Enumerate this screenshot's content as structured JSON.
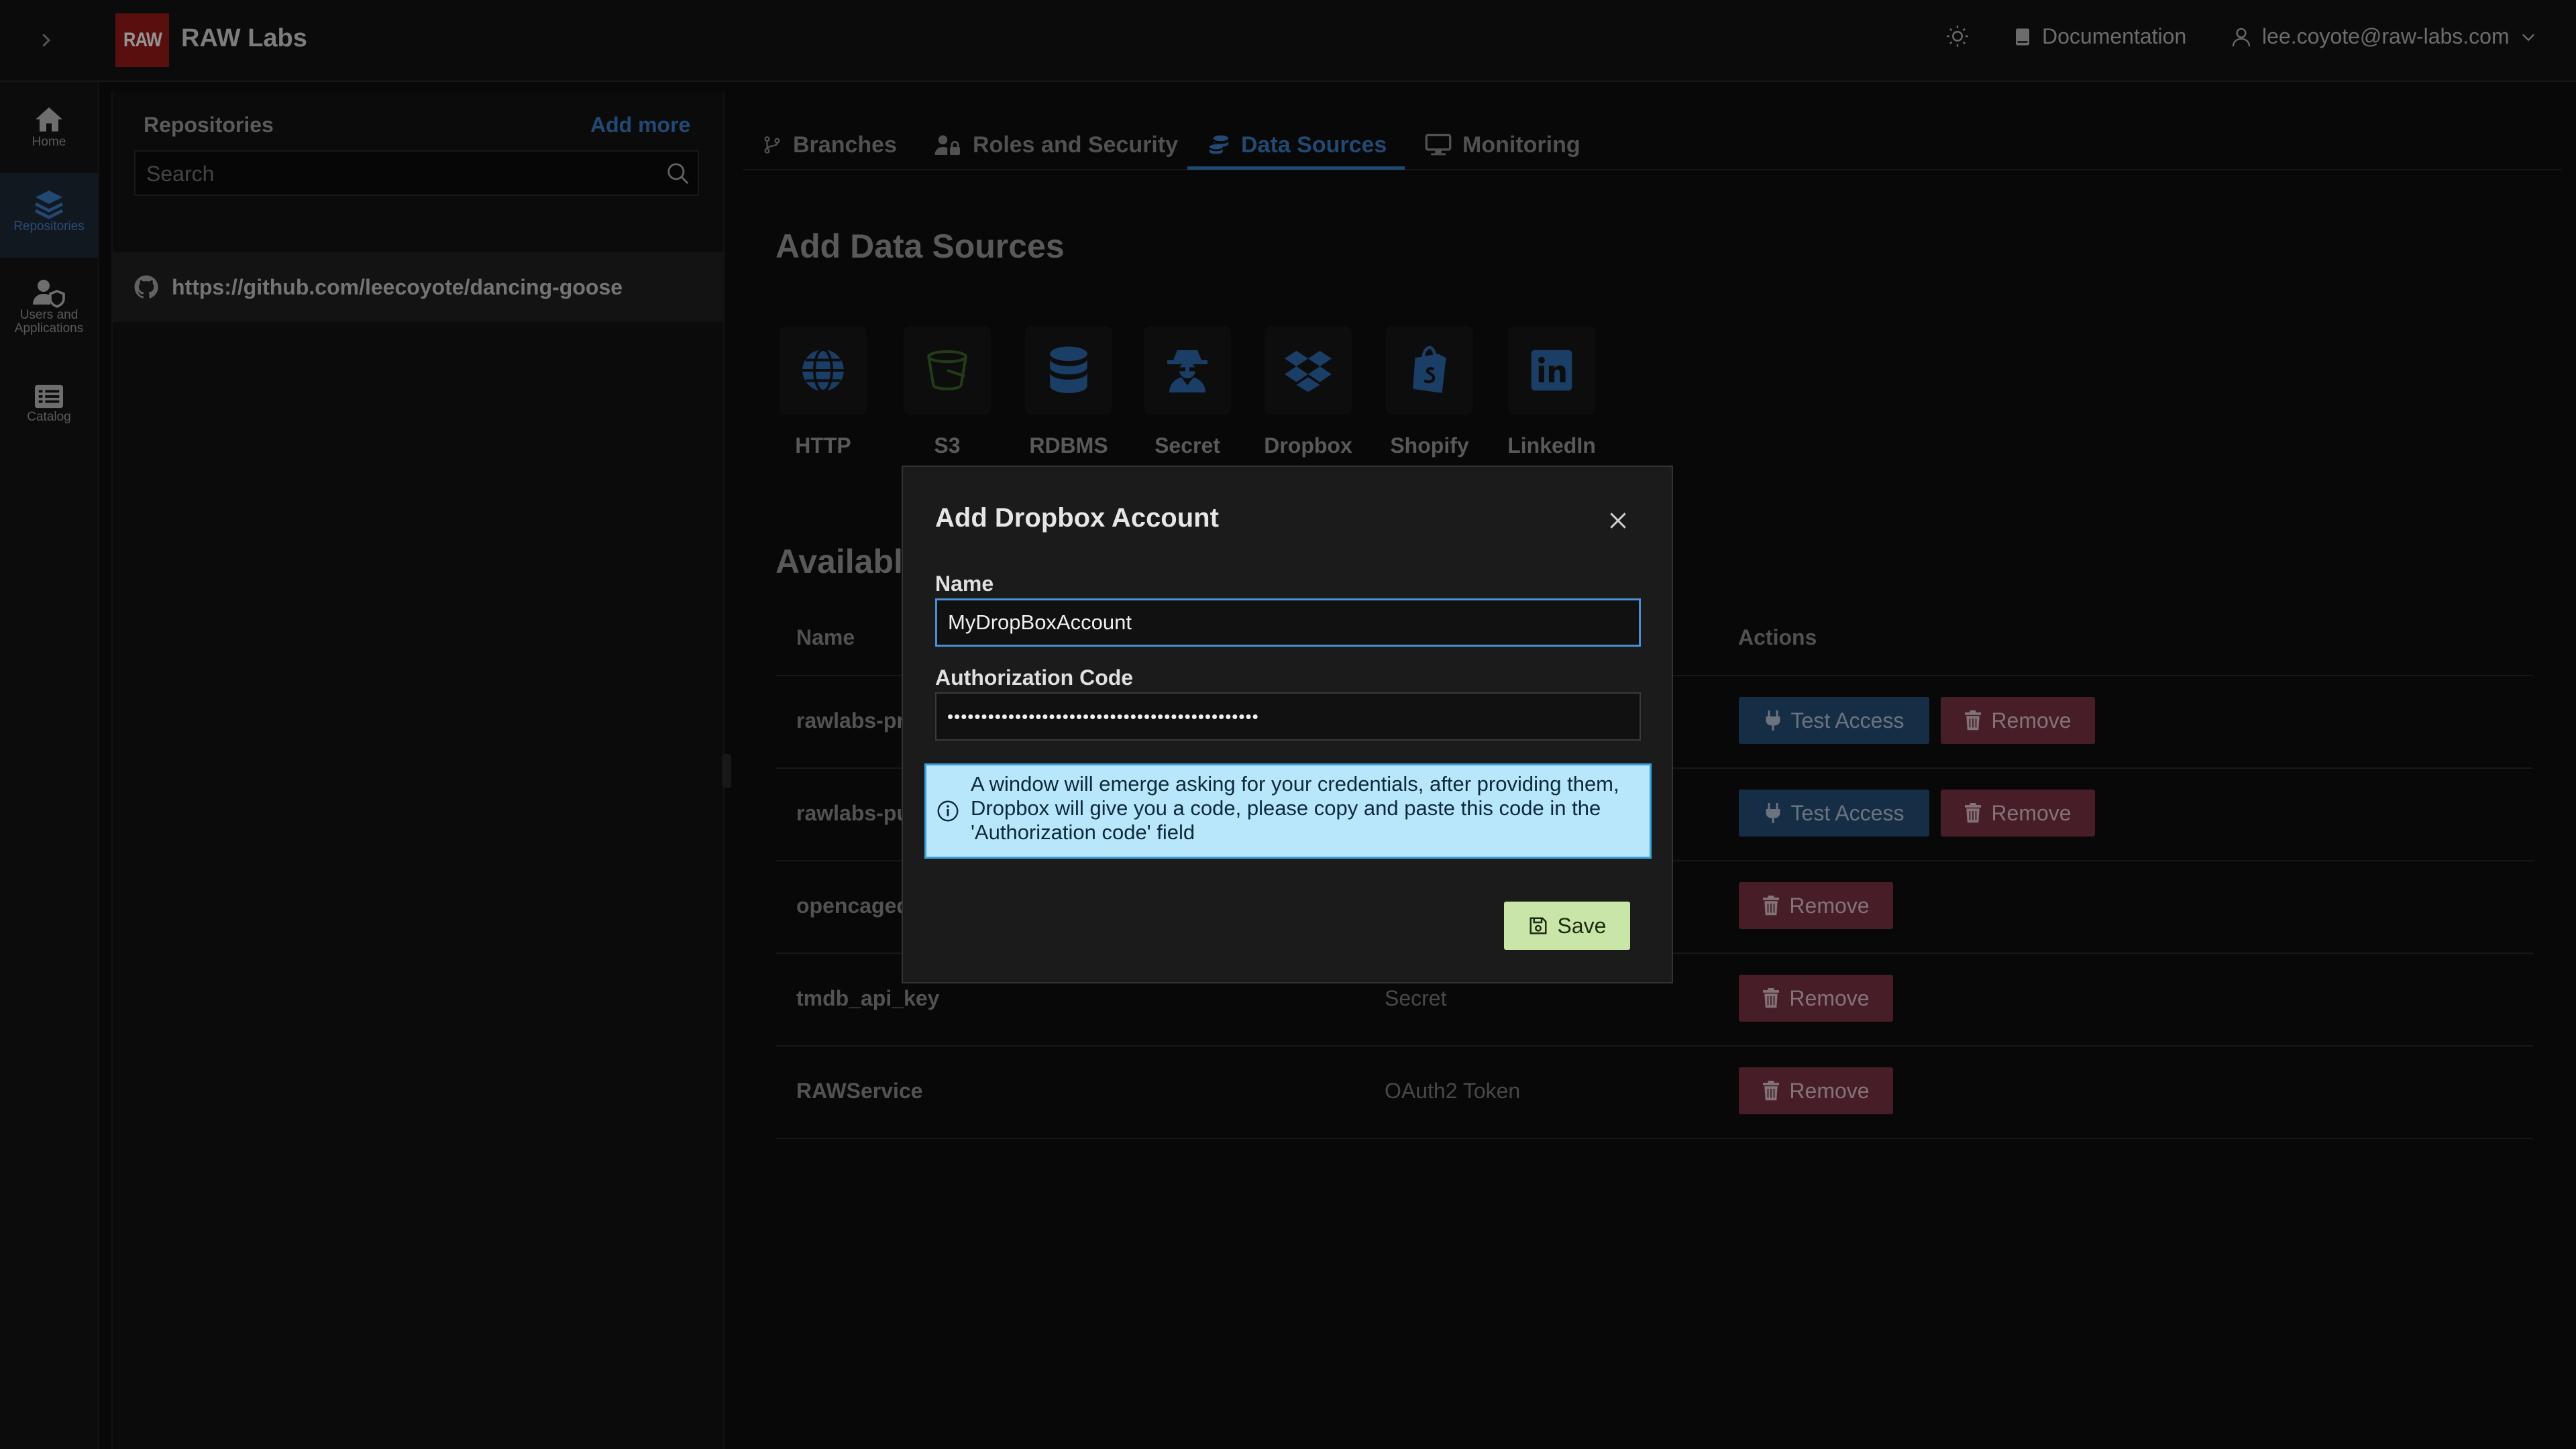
{
  "topbar": {
    "logo_text": "RAW",
    "app_title": "RAW Labs",
    "documentation_label": "Documentation",
    "user_email": "lee.coyote@raw-labs.com"
  },
  "leftnav": {
    "items": [
      {
        "label": "Home",
        "icon": "home-icon"
      },
      {
        "label": "Repositories",
        "icon": "layers-icon"
      },
      {
        "label": "Users and Applications",
        "icon": "users-shield-icon"
      },
      {
        "label": "Catalog",
        "icon": "list-icon"
      }
    ]
  },
  "repos": {
    "title": "Repositories",
    "add_more_label": "Add more",
    "search_placeholder": "Search",
    "items": [
      {
        "url": "https://github.com/leecoyote/dancing-goose",
        "icon": "github-icon"
      }
    ]
  },
  "tabs": [
    {
      "label": "Branches",
      "icon": "branch-icon"
    },
    {
      "label": "Roles and Security",
      "icon": "user-lock-icon"
    },
    {
      "label": "Data Sources",
      "icon": "coins-icon",
      "active": true
    },
    {
      "label": "Monitoring",
      "icon": "monitor-icon"
    }
  ],
  "add_sources": {
    "title": "Add Data Sources",
    "types": [
      {
        "label": "HTTP",
        "icon": "globe-icon"
      },
      {
        "label": "S3",
        "icon": "bucket-icon"
      },
      {
        "label": "RDBMS",
        "icon": "database-icon"
      },
      {
        "label": "Secret",
        "icon": "user-secret-icon"
      },
      {
        "label": "Dropbox",
        "icon": "dropbox-icon"
      },
      {
        "label": "Shopify",
        "icon": "shopify-icon"
      },
      {
        "label": "LinkedIn",
        "icon": "linkedin-icon"
      }
    ]
  },
  "available": {
    "title_visible": "Availabl",
    "headers": {
      "name": "Name",
      "actions": "Actions"
    },
    "rows": [
      {
        "name": "rawlabs-pr",
        "type": "",
        "test": true
      },
      {
        "name": "rawlabs-pu",
        "type": "",
        "test": true
      },
      {
        "name": "opencaged",
        "type": "",
        "test": false
      },
      {
        "name": "tmdb_api_key",
        "type": "Secret",
        "test": false
      },
      {
        "name": "RAWService",
        "type": "OAuth2 Token",
        "test": false
      }
    ],
    "test_label": "Test Access",
    "remove_label": "Remove"
  },
  "modal": {
    "title": "Add Dropbox Account",
    "name_label": "Name",
    "name_value": "MyDropBoxAccount",
    "auth_label": "Authorization Code",
    "auth_value": "••••••••••••••••••••••••••••••••••••••••••••••",
    "info_text": "A window will emerge asking for your credentials, after providing them, Dropbox will give you a code, please copy and paste this code in the 'Authorization code' field",
    "save_label": "Save"
  },
  "colors": {
    "accent": "#3a7fc9",
    "brand": "#9b1b1b",
    "test_button": "#274f79",
    "remove_button": "#7a3346",
    "save_button": "#c9e6a8",
    "info_bg": "#b8e6fb"
  }
}
